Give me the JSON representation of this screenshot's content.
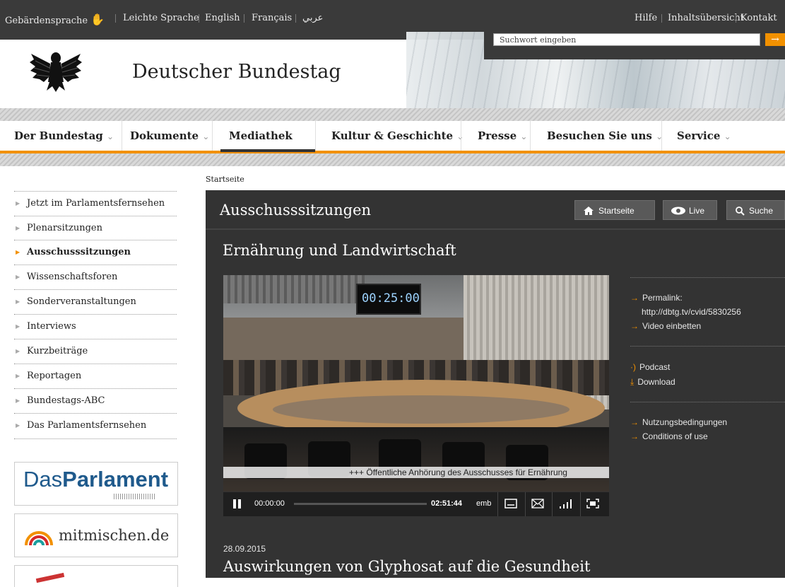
{
  "topbar": {
    "links": [
      "Gebärdensprache",
      "Leichte Sprache",
      "English",
      "Français",
      "عربي"
    ],
    "right_links": [
      "Hilfe",
      "Inhaltsübersicht",
      "Kontakt"
    ],
    "search_placeholder": "Suchwort eingeben"
  },
  "brand": {
    "name": "Deutscher Bundestag"
  },
  "nav": {
    "items": [
      "Der Bundestag",
      "Dokumente",
      "Mediathek",
      "Kultur & Geschichte",
      "Presse",
      "Besuchen Sie uns",
      "Service"
    ],
    "active": "Mediathek"
  },
  "sidebar": {
    "items": [
      "Jetzt im Parlamentsfernsehen",
      "Plenarsitzungen",
      "Ausschusssitzungen",
      "Wissenschaftsforen",
      "Sonderveranstaltungen",
      "Interviews",
      "Kurzbeiträge",
      "Reportagen",
      "Bundestags-ABC",
      "Das Parlamentsfernsehen"
    ],
    "active": "Ausschusssitzungen",
    "ads": {
      "das": "Das",
      "parlament": "Parlament",
      "mitmischen": "mitmischen.de"
    }
  },
  "breadcrumb": "Startseite",
  "panel": {
    "title": "Ausschusssitzungen",
    "buttons": {
      "home": "Startseite",
      "live": "Live",
      "search": "Suche"
    },
    "subtitle": "Ernährung und Landwirtschaft"
  },
  "video": {
    "clock": "00:25:00",
    "ticker": "+++  Öffentliche Anhörung des Ausschusses für Ernährung",
    "time_current": "00:00:00",
    "time_total": "02:51:44",
    "embed_label": "emb",
    "progress": 0
  },
  "side_links": {
    "permalink_label": "Permalink:",
    "permalink_url": "http://dbtg.tv/cvid/5830256",
    "embed": "Video einbetten",
    "podcast": "Podcast",
    "download": "Download",
    "terms_de": "Nutzungsbedingungen",
    "terms_en": "Conditions of use"
  },
  "article": {
    "date": "28.09.2015",
    "title": "Auswirkungen von Glyphosat auf die Gesundheit"
  },
  "colors": {
    "accent": "#f29100",
    "panel": "#333333",
    "topbar": "#3a3a3a"
  },
  "icons": [
    "hand-sign-icon",
    "eagle-icon",
    "arrow-right-icon",
    "home-icon",
    "eye-icon",
    "search-icon",
    "pause-icon",
    "subtitle-icon",
    "mail-icon",
    "bars-icon",
    "fullscreen-icon",
    "podcast-icon",
    "download-icon"
  ]
}
